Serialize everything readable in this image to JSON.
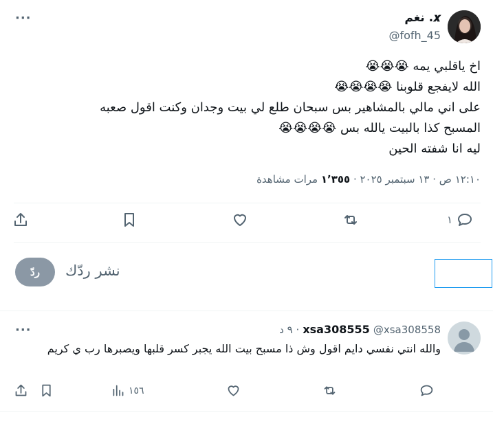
{
  "tweet": {
    "author_name": "𝒙. نغم",
    "author_handle": "@fofh_45",
    "text_lines": [
      "اخ ياقلبي يمه 😭😭😭",
      "الله لايفجع قلوبنا 😭😭😭😭",
      "على اني مالي بالمشاهير بس سبحان طلع لي بيت وجدان وكنت اقول صعبه",
      "المسبح كذا بالبيت يالله بس 😭😭😭😭",
      "ليه انا شفته الحين"
    ],
    "timestamp": "١٢:١٠ ص · ١٣ سبتمبر ٢٠٢٥ ·",
    "views_count": "١٬٣٥٥",
    "views_label": "مرات مشاهدة",
    "reply_count": "١",
    "more_label": "···"
  },
  "composer": {
    "placeholder": "نشر ردّك",
    "reply_button_label": "ردّ"
  },
  "reply": {
    "author_name": "xsa308555",
    "author_handle": "@xsa308558",
    "age": "· ٩ د",
    "text": "والله انتي نفسي دايم اقول وش ذا مسبح بيت الله يجبر كسر قلبها ويصبرها رب ي كريم",
    "views_count": "١٥٦",
    "more_label": "···"
  }
}
